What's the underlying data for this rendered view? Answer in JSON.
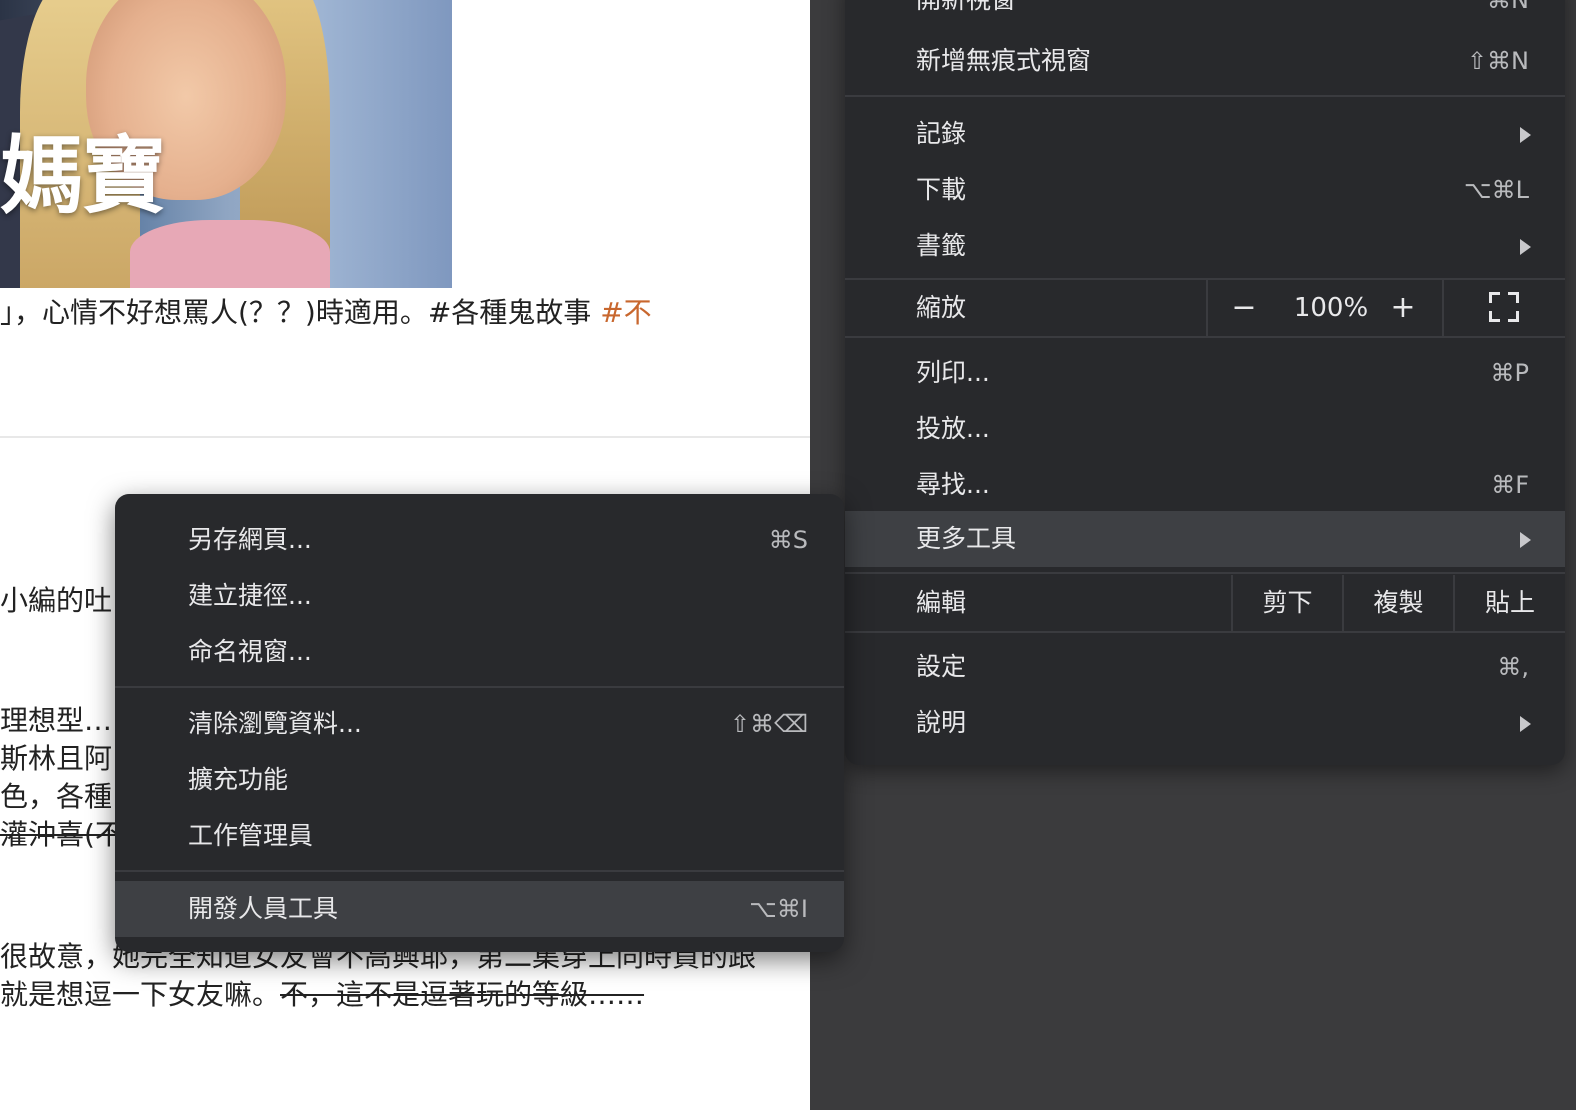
{
  "page": {
    "hero_title": "媽寶",
    "line1_main": "」，心情不好想罵人(？？)時適用。#各種鬼故事 ",
    "line1_accent": "#不",
    "left_fragments": [
      "小編的吐",
      "理想型…",
      "斯林且阿",
      "色，各種",
      "灌沖喜(不"
    ],
    "line_bottom1": "很故意，她完全知道女友會不高興耶，第二集穿上同時買的跟",
    "line_bottom2_plain": "就是想逗一下女友嘛。",
    "line_bottom2_strike": "不，這不是逗著玩的等級……"
  },
  "main_menu": {
    "new_window": {
      "label": "開新視窗",
      "shortcut": "⌘N"
    },
    "new_incognito": {
      "label": "新增無痕式視窗",
      "shortcut": "⇧⌘N"
    },
    "history": {
      "label": "記錄"
    },
    "downloads": {
      "label": "下載",
      "shortcut": "⌥⌘L"
    },
    "bookmarks": {
      "label": "書籤"
    },
    "zoom": {
      "label": "縮放",
      "minus": "−",
      "value": "100%",
      "plus": "+"
    },
    "print": {
      "label": "列印...",
      "shortcut": "⌘P"
    },
    "cast": {
      "label": "投放..."
    },
    "find": {
      "label": "尋找...",
      "shortcut": "⌘F"
    },
    "more_tools": {
      "label": "更多工具"
    },
    "edit": {
      "label": "編輯",
      "cut": "剪下",
      "copy": "複製",
      "paste": "貼上"
    },
    "settings": {
      "label": "設定",
      "shortcut": "⌘,"
    },
    "help": {
      "label": "說明"
    }
  },
  "sub_menu": {
    "save_page": {
      "label": "另存網頁...",
      "shortcut": "⌘S"
    },
    "create_shortcut": {
      "label": "建立捷徑..."
    },
    "name_window": {
      "label": "命名視窗..."
    },
    "clear_data": {
      "label": "清除瀏覽資料...",
      "shortcut": "⇧⌘⌫"
    },
    "extensions": {
      "label": "擴充功能"
    },
    "task_manager": {
      "label": "工作管理員"
    },
    "dev_tools": {
      "label": "開發人員工具",
      "shortcut": "⌥⌘I"
    }
  },
  "colors": {
    "menu_bg": "#28292c",
    "menu_active": "#3e4044",
    "hashtag_accent": "#c8672e"
  }
}
